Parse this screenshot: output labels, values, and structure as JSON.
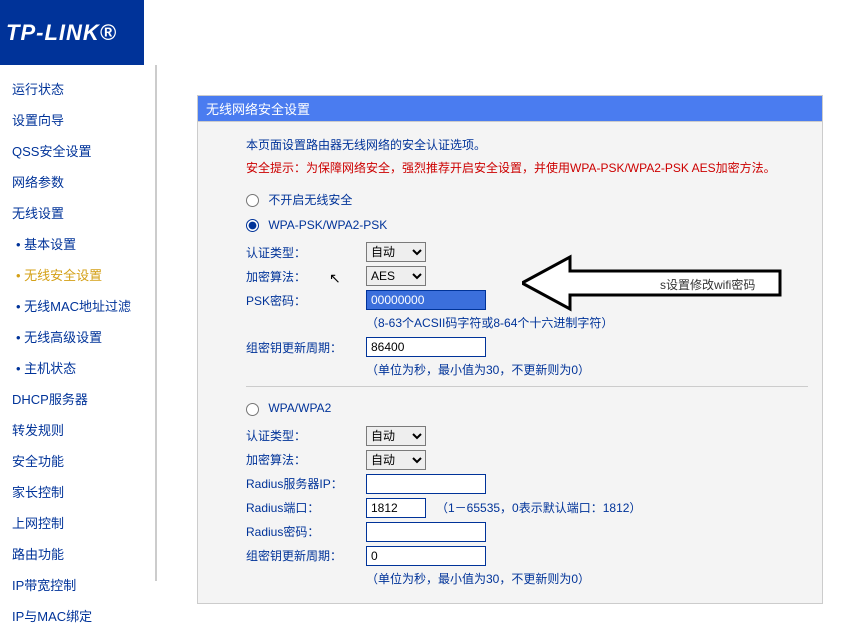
{
  "header": {
    "logo": "TP-LINK®"
  },
  "sidebar": {
    "items": [
      {
        "label": "运行状态",
        "type": "item"
      },
      {
        "label": "设置向导",
        "type": "item"
      },
      {
        "label": "QSS安全设置",
        "type": "item"
      },
      {
        "label": "网络参数",
        "type": "item"
      },
      {
        "label": "无线设置",
        "type": "item"
      },
      {
        "label": "基本设置",
        "type": "sub"
      },
      {
        "label": "无线安全设置",
        "type": "sub",
        "active": true
      },
      {
        "label": "无线MAC地址过滤",
        "type": "sub"
      },
      {
        "label": "无线高级设置",
        "type": "sub"
      },
      {
        "label": "主机状态",
        "type": "sub"
      },
      {
        "label": "DHCP服务器",
        "type": "item"
      },
      {
        "label": "转发规则",
        "type": "item"
      },
      {
        "label": "安全功能",
        "type": "item"
      },
      {
        "label": "家长控制",
        "type": "item"
      },
      {
        "label": "上网控制",
        "type": "item"
      },
      {
        "label": "路由功能",
        "type": "item"
      },
      {
        "label": "IP带宽控制",
        "type": "item"
      },
      {
        "label": "IP与MAC绑定",
        "type": "item"
      }
    ]
  },
  "panel": {
    "title": "无线网络安全设置",
    "intro": "本页面设置路由器无线网络的安全认证选项。",
    "warning": "安全提示：为保障网络安全，强烈推荐开启安全设置，并使用WPA-PSK/WPA2-PSK AES加密方法。",
    "radio_off": "不开启无线安全",
    "radio_wpa_psk": "WPA-PSK/WPA2-PSK",
    "radio_wpa": "WPA/WPA2",
    "sec1": {
      "auth_label": "认证类型：",
      "auth_value": "自动",
      "enc_label": "加密算法：",
      "enc_value": "AES",
      "psk_label": "PSK密码：",
      "psk_value": "00000000",
      "psk_hint": "（8-63个ACSII码字符或8-64个十六进制字符）",
      "rekey_label": "组密钥更新周期：",
      "rekey_value": "86400",
      "rekey_hint": "（单位为秒，最小值为30，不更新则为0）"
    },
    "sec2": {
      "auth_label": "认证类型：",
      "auth_value": "自动",
      "enc_label": "加密算法：",
      "enc_value": "自动",
      "radius_ip_label": "Radius服务器IP：",
      "radius_ip_value": "",
      "radius_port_label": "Radius端口：",
      "radius_port_value": "1812",
      "radius_port_hint": "（1－65535，0表示默认端口：1812）",
      "radius_pwd_label": "Radius密码：",
      "radius_pwd_value": "",
      "rekey_label": "组密钥更新周期：",
      "rekey_value": "0",
      "rekey_hint": "（单位为秒，最小值为30，不更新则为0）"
    }
  },
  "annotation": {
    "arrow_text": "s设置修改wifi密码"
  }
}
